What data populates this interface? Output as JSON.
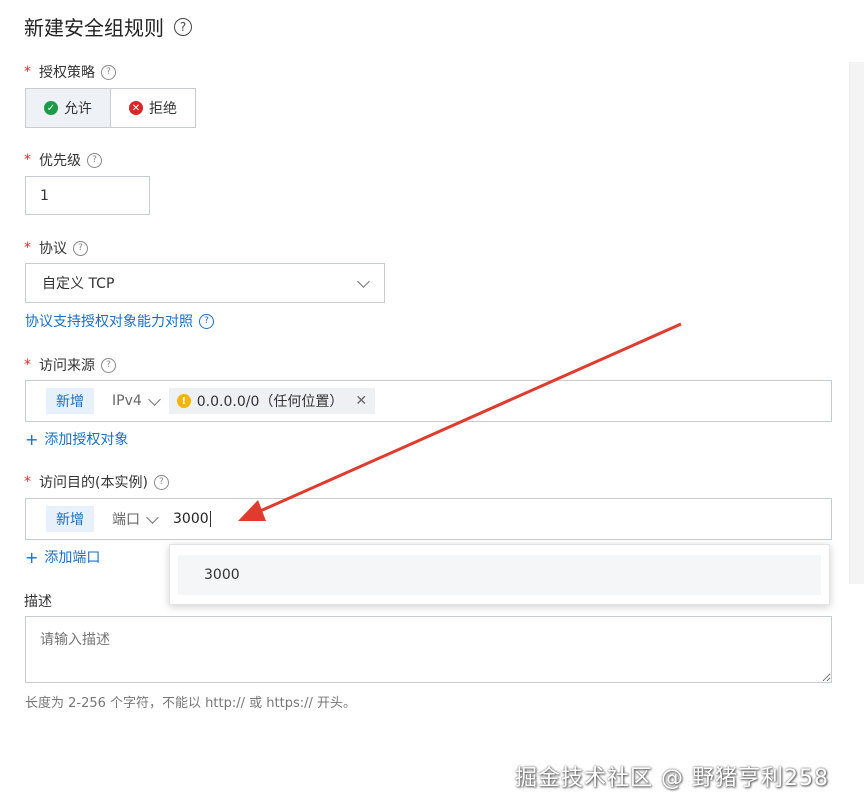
{
  "header": {
    "title": "新建安全组规则"
  },
  "policy": {
    "label": "授权策略",
    "options": [
      {
        "label": "允许",
        "selected": true
      },
      {
        "label": "拒绝",
        "selected": false
      }
    ]
  },
  "priority": {
    "label": "优先级",
    "value": "1"
  },
  "protocol": {
    "label": "协议",
    "value": "自定义 TCP",
    "link": "协议支持授权对象能力对照"
  },
  "source": {
    "label": "访问来源",
    "tag": "新增",
    "type": "IPv4",
    "chip": "0.0.0.0/0（任何位置）",
    "add_link": "添加授权对象"
  },
  "destination": {
    "label": "访问目的(本实例)",
    "tag": "新增",
    "type": "端口",
    "value": "3000",
    "add_link": "添加端口",
    "suggestion": "3000"
  },
  "description": {
    "label": "描述",
    "placeholder": "请输入描述",
    "hint": "长度为 2-256 个字符，不能以 http:// 或 https:// 开头。"
  },
  "watermark": "掘金技术社区 @ 野猪亨利258",
  "colors": {
    "accent": "#1a6fc4",
    "required": "#d93026",
    "arrow": "#e03b2f"
  }
}
